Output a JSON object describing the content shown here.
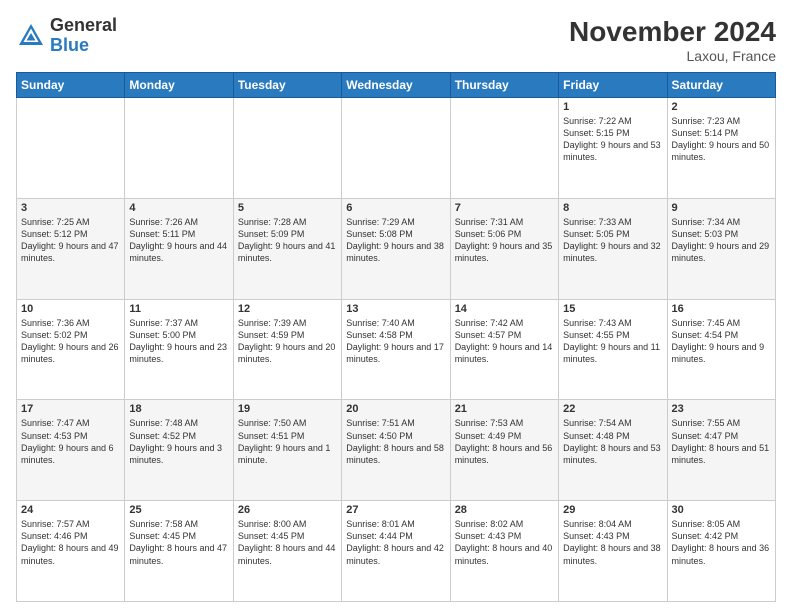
{
  "header": {
    "logo_general": "General",
    "logo_blue": "Blue",
    "month_title": "November 2024",
    "location": "Laxou, France"
  },
  "days_of_week": [
    "Sunday",
    "Monday",
    "Tuesday",
    "Wednesday",
    "Thursday",
    "Friday",
    "Saturday"
  ],
  "weeks": [
    [
      {
        "day": "",
        "info": ""
      },
      {
        "day": "",
        "info": ""
      },
      {
        "day": "",
        "info": ""
      },
      {
        "day": "",
        "info": ""
      },
      {
        "day": "",
        "info": ""
      },
      {
        "day": "1",
        "info": "Sunrise: 7:22 AM\nSunset: 5:15 PM\nDaylight: 9 hours and 53 minutes."
      },
      {
        "day": "2",
        "info": "Sunrise: 7:23 AM\nSunset: 5:14 PM\nDaylight: 9 hours and 50 minutes."
      }
    ],
    [
      {
        "day": "3",
        "info": "Sunrise: 7:25 AM\nSunset: 5:12 PM\nDaylight: 9 hours and 47 minutes."
      },
      {
        "day": "4",
        "info": "Sunrise: 7:26 AM\nSunset: 5:11 PM\nDaylight: 9 hours and 44 minutes."
      },
      {
        "day": "5",
        "info": "Sunrise: 7:28 AM\nSunset: 5:09 PM\nDaylight: 9 hours and 41 minutes."
      },
      {
        "day": "6",
        "info": "Sunrise: 7:29 AM\nSunset: 5:08 PM\nDaylight: 9 hours and 38 minutes."
      },
      {
        "day": "7",
        "info": "Sunrise: 7:31 AM\nSunset: 5:06 PM\nDaylight: 9 hours and 35 minutes."
      },
      {
        "day": "8",
        "info": "Sunrise: 7:33 AM\nSunset: 5:05 PM\nDaylight: 9 hours and 32 minutes."
      },
      {
        "day": "9",
        "info": "Sunrise: 7:34 AM\nSunset: 5:03 PM\nDaylight: 9 hours and 29 minutes."
      }
    ],
    [
      {
        "day": "10",
        "info": "Sunrise: 7:36 AM\nSunset: 5:02 PM\nDaylight: 9 hours and 26 minutes."
      },
      {
        "day": "11",
        "info": "Sunrise: 7:37 AM\nSunset: 5:00 PM\nDaylight: 9 hours and 23 minutes."
      },
      {
        "day": "12",
        "info": "Sunrise: 7:39 AM\nSunset: 4:59 PM\nDaylight: 9 hours and 20 minutes."
      },
      {
        "day": "13",
        "info": "Sunrise: 7:40 AM\nSunset: 4:58 PM\nDaylight: 9 hours and 17 minutes."
      },
      {
        "day": "14",
        "info": "Sunrise: 7:42 AM\nSunset: 4:57 PM\nDaylight: 9 hours and 14 minutes."
      },
      {
        "day": "15",
        "info": "Sunrise: 7:43 AM\nSunset: 4:55 PM\nDaylight: 9 hours and 11 minutes."
      },
      {
        "day": "16",
        "info": "Sunrise: 7:45 AM\nSunset: 4:54 PM\nDaylight: 9 hours and 9 minutes."
      }
    ],
    [
      {
        "day": "17",
        "info": "Sunrise: 7:47 AM\nSunset: 4:53 PM\nDaylight: 9 hours and 6 minutes."
      },
      {
        "day": "18",
        "info": "Sunrise: 7:48 AM\nSunset: 4:52 PM\nDaylight: 9 hours and 3 minutes."
      },
      {
        "day": "19",
        "info": "Sunrise: 7:50 AM\nSunset: 4:51 PM\nDaylight: 9 hours and 1 minute."
      },
      {
        "day": "20",
        "info": "Sunrise: 7:51 AM\nSunset: 4:50 PM\nDaylight: 8 hours and 58 minutes."
      },
      {
        "day": "21",
        "info": "Sunrise: 7:53 AM\nSunset: 4:49 PM\nDaylight: 8 hours and 56 minutes."
      },
      {
        "day": "22",
        "info": "Sunrise: 7:54 AM\nSunset: 4:48 PM\nDaylight: 8 hours and 53 minutes."
      },
      {
        "day": "23",
        "info": "Sunrise: 7:55 AM\nSunset: 4:47 PM\nDaylight: 8 hours and 51 minutes."
      }
    ],
    [
      {
        "day": "24",
        "info": "Sunrise: 7:57 AM\nSunset: 4:46 PM\nDaylight: 8 hours and 49 minutes."
      },
      {
        "day": "25",
        "info": "Sunrise: 7:58 AM\nSunset: 4:45 PM\nDaylight: 8 hours and 47 minutes."
      },
      {
        "day": "26",
        "info": "Sunrise: 8:00 AM\nSunset: 4:45 PM\nDaylight: 8 hours and 44 minutes."
      },
      {
        "day": "27",
        "info": "Sunrise: 8:01 AM\nSunset: 4:44 PM\nDaylight: 8 hours and 42 minutes."
      },
      {
        "day": "28",
        "info": "Sunrise: 8:02 AM\nSunset: 4:43 PM\nDaylight: 8 hours and 40 minutes."
      },
      {
        "day": "29",
        "info": "Sunrise: 8:04 AM\nSunset: 4:43 PM\nDaylight: 8 hours and 38 minutes."
      },
      {
        "day": "30",
        "info": "Sunrise: 8:05 AM\nSunset: 4:42 PM\nDaylight: 8 hours and 36 minutes."
      }
    ]
  ]
}
